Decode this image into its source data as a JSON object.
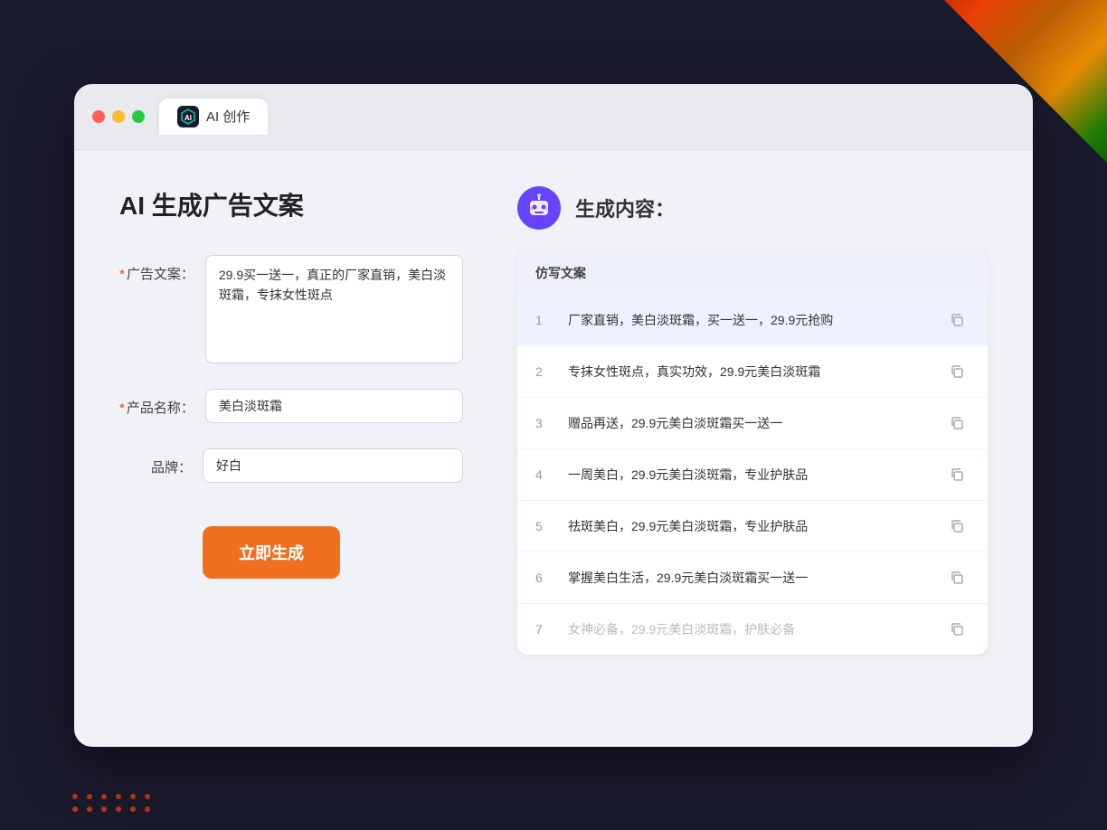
{
  "window": {
    "tab_icon": "AI",
    "tab_label": "AI 创作"
  },
  "left_panel": {
    "title": "AI 生成广告文案",
    "fields": [
      {
        "id": "ad_copy",
        "label": "广告文案：",
        "required": true,
        "type": "textarea",
        "value": "29.9买一送一，真正的厂家直销，美白淡斑霜，专抹女性斑点"
      },
      {
        "id": "product_name",
        "label": "产品名称：",
        "required": true,
        "type": "input",
        "value": "美白淡斑霜"
      },
      {
        "id": "brand",
        "label": "品牌：",
        "required": false,
        "type": "input",
        "value": "好白"
      }
    ],
    "generate_button": "立即生成"
  },
  "right_panel": {
    "title": "生成内容：",
    "table_header": "仿写文案",
    "results": [
      {
        "id": 1,
        "text": "厂家直销，美白淡斑霜，买一送一，29.9元抢购",
        "faded": false
      },
      {
        "id": 2,
        "text": "专抹女性斑点，真实功效，29.9元美白淡斑霜",
        "faded": false
      },
      {
        "id": 3,
        "text": "赠品再送，29.9元美白淡斑霜买一送一",
        "faded": false
      },
      {
        "id": 4,
        "text": "一周美白，29.9元美白淡斑霜，专业护肤品",
        "faded": false
      },
      {
        "id": 5,
        "text": "祛斑美白，29.9元美白淡斑霜，专业护肤品",
        "faded": false
      },
      {
        "id": 6,
        "text": "掌握美白生活，29.9元美白淡斑霜买一送一",
        "faded": false
      },
      {
        "id": 7,
        "text": "女神必备，29.9元美白淡斑霜，护肤必备",
        "faded": true
      }
    ]
  }
}
